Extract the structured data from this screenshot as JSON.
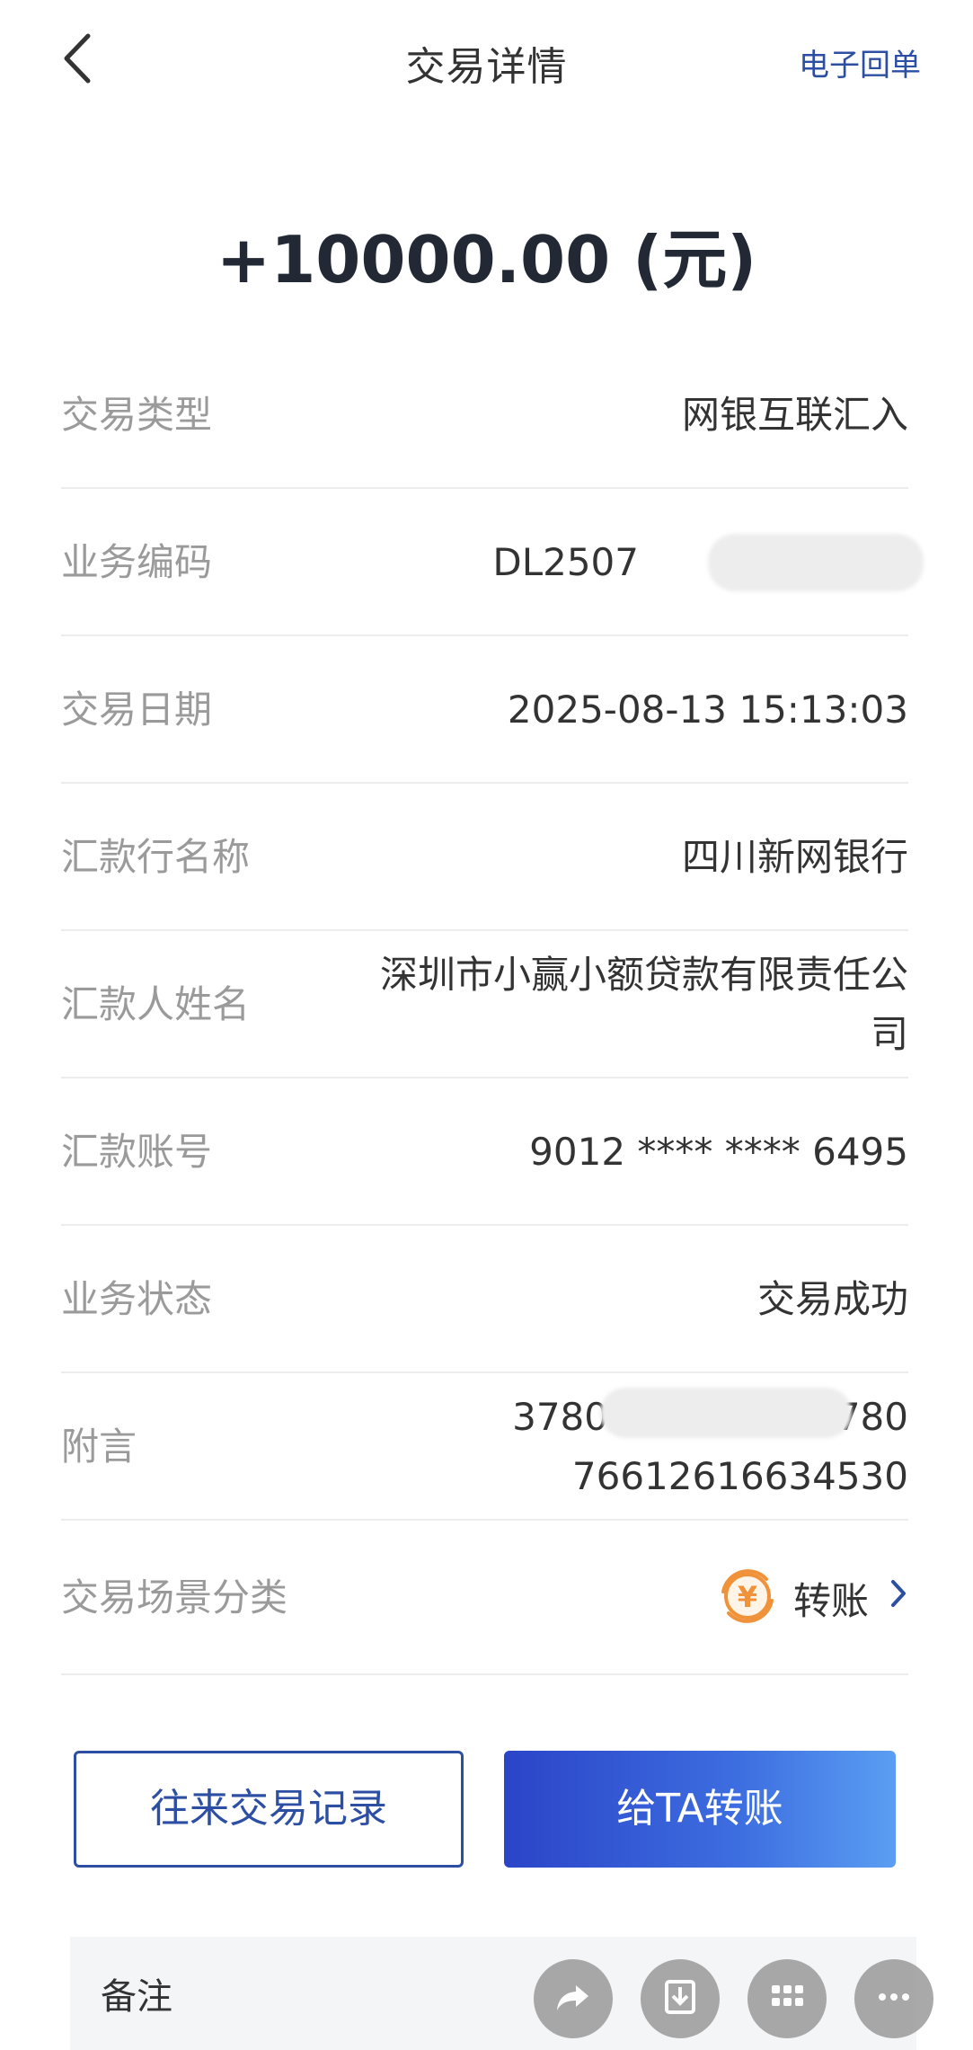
{
  "header": {
    "title": "交易详情",
    "receipt_link": "电子回单"
  },
  "amount": "+10000.00 (元)",
  "details": [
    {
      "label": "交易类型",
      "value": "网银互联汇入"
    },
    {
      "label": "业务编码",
      "value": "DL2507"
    },
    {
      "label": "交易日期",
      "value": "2025-08-13 15:13:03"
    },
    {
      "label": "汇款行名称",
      "value": "四川新网银行"
    },
    {
      "label": "汇款人姓名",
      "value": "深圳市小赢小额贷款有限责任公司"
    },
    {
      "label": "汇款账号",
      "value": "9012 **** **** 6495"
    },
    {
      "label": "业务状态",
      "value": "交易成功"
    },
    {
      "label": "附言",
      "value": "378076294793  5780 76612616634530"
    }
  ],
  "scene": {
    "label": "交易场景分类",
    "value": "转账",
    "icon_symbol": "¥"
  },
  "buttons": {
    "history": "往来交易记录",
    "transfer": "给TA转账"
  },
  "remarks": {
    "label": "备注"
  },
  "colors": {
    "accent": "#2d4fa3",
    "transfer_gradient_start": "#2b44c8",
    "transfer_gradient_end": "#5a9ef2",
    "scene_icon": "#f0923a"
  }
}
